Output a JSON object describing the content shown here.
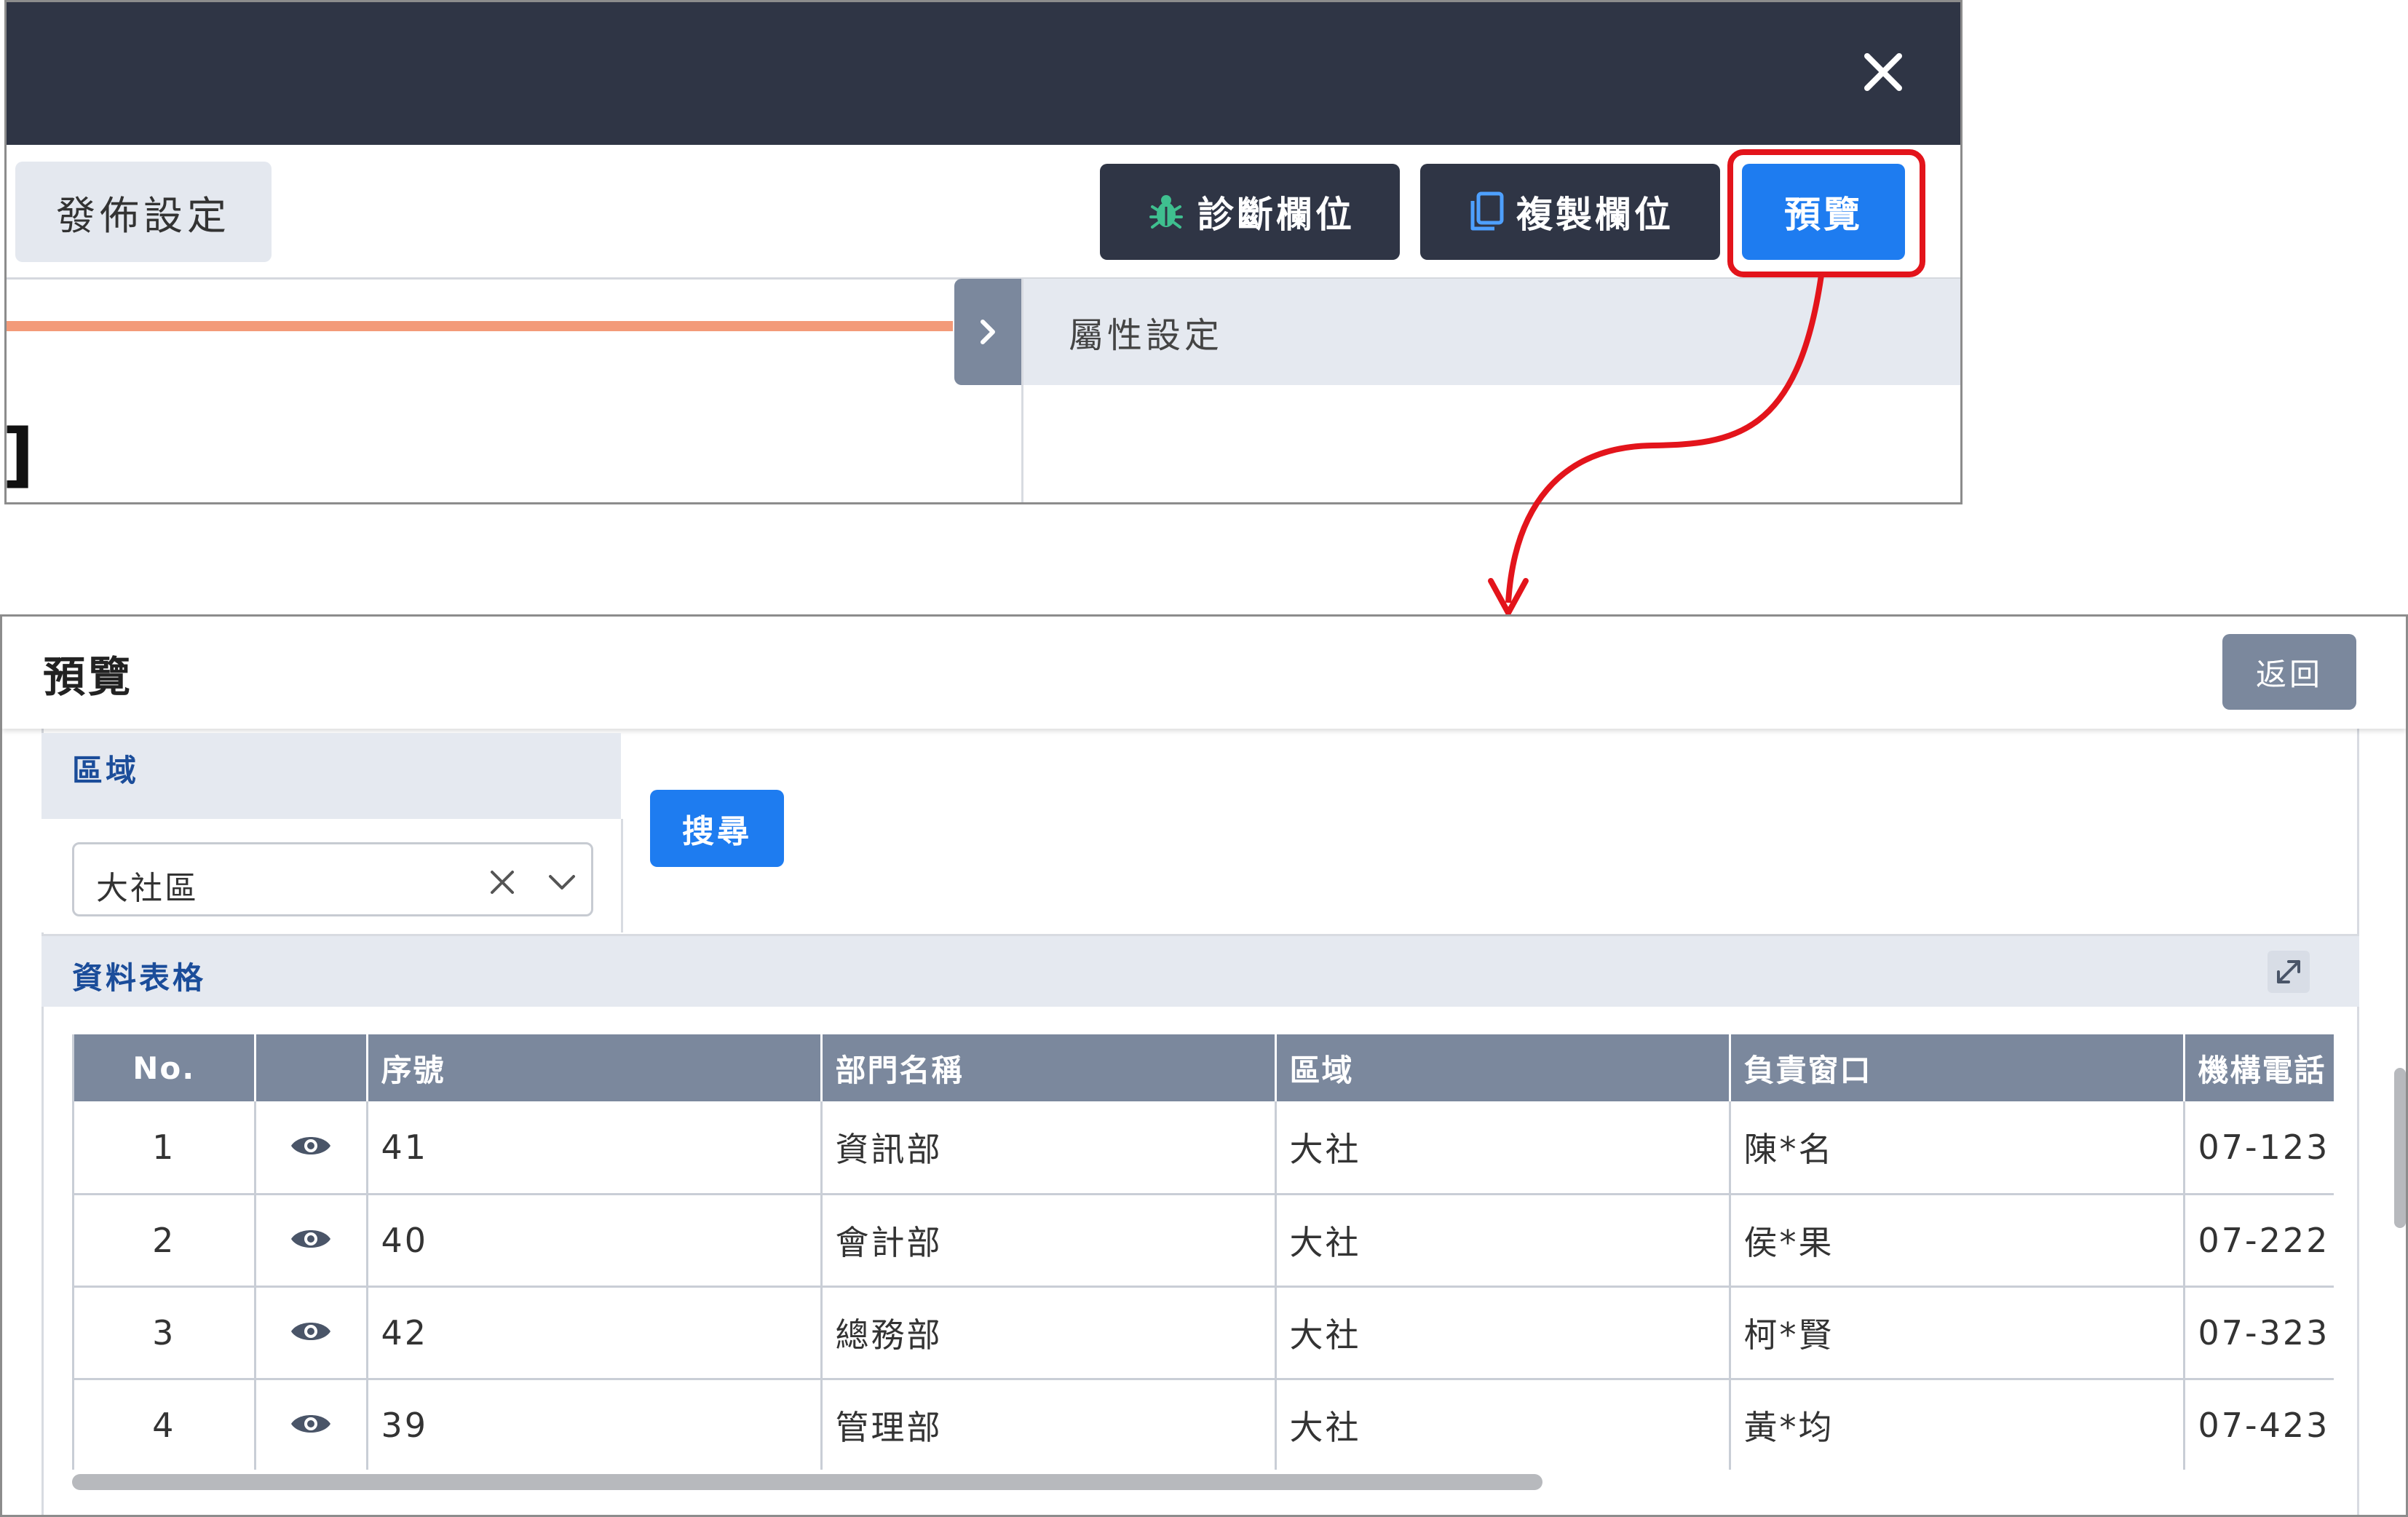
{
  "editor": {
    "publish_label": "發佈設定",
    "diagnose_label": "診斷欄位",
    "copy_label": "複製欄位",
    "preview_label": "預覽",
    "property_panel_title": "屬性設定",
    "cut_text": "]"
  },
  "preview": {
    "title": "預覽",
    "back_label": "返回",
    "filter": {
      "region_label": "區域",
      "region_value": "大社區",
      "search_label": "搜尋"
    },
    "grid": {
      "title": "資料表格",
      "columns": [
        "No.",
        "",
        "序號",
        "部門名稱",
        "區域",
        "負責窗口",
        "機構電話"
      ],
      "rows": [
        {
          "no": "1",
          "serial": "41",
          "dept": "資訊部",
          "region": "大社",
          "contact": "陳*名",
          "phone": "07-123"
        },
        {
          "no": "2",
          "serial": "40",
          "dept": "會計部",
          "region": "大社",
          "contact": "侯*果",
          "phone": "07-222"
        },
        {
          "no": "3",
          "serial": "42",
          "dept": "總務部",
          "region": "大社",
          "contact": "柯*賢",
          "phone": "07-323"
        },
        {
          "no": "4",
          "serial": "39",
          "dept": "管理部",
          "region": "大社",
          "contact": "黃*均",
          "phone": "07-423"
        }
      ]
    }
  },
  "colors": {
    "topbar": "#2f3545",
    "primary": "#1e7cf0",
    "highlight": "#e3141b",
    "header_gray": "#7b889d",
    "section_title": "#1b4d9a"
  }
}
